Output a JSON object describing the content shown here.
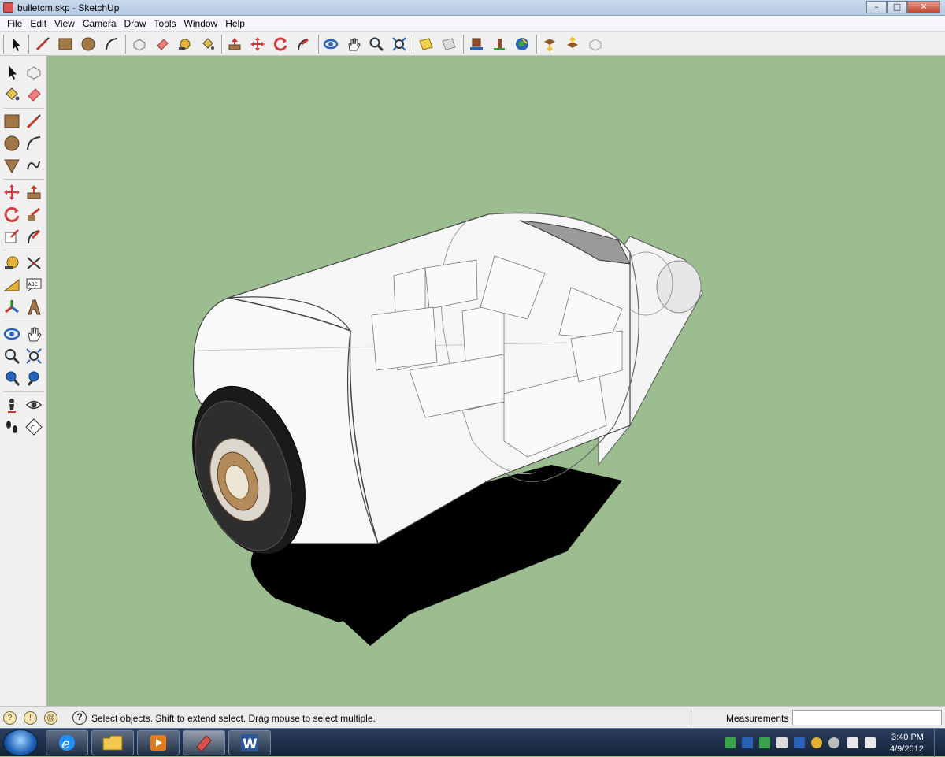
{
  "window": {
    "title": "bulletcm.skp - SketchUp",
    "buttons": {
      "minimize": "–",
      "maximize": "□",
      "close": "✕"
    }
  },
  "menu": [
    "File",
    "Edit",
    "View",
    "Camera",
    "Draw",
    "Tools",
    "Window",
    "Help"
  ],
  "toolbar": {
    "tools": [
      "select-icon",
      "line-icon",
      "rectangle-icon",
      "circle-icon",
      "arc-icon",
      "make-component-icon",
      "eraser-icon",
      "tape-measure-icon",
      "paint-bucket-icon",
      "push-pull-icon",
      "move-icon",
      "rotate-icon",
      "follow-me-icon",
      "orbit-icon",
      "pan-icon",
      "zoom-icon",
      "zoom-extents-icon",
      "add-location-icon",
      "toggle-terrain-icon",
      "get-models-icon",
      "share-model-icon",
      "place-model-icon",
      "get-components-icon",
      "share-component-icon",
      "send-to-layout-icon"
    ]
  },
  "left_tools": [
    "select-icon",
    "make-component-icon",
    "paint-bucket-icon",
    "eraser-icon",
    "rectangle-icon",
    "line-icon",
    "circle-icon",
    "arc-icon",
    "polygon-icon",
    "freehand-icon",
    "move-icon",
    "push-pull-icon",
    "rotate-icon",
    "follow-me-icon",
    "scale-icon",
    "offset-icon",
    "tape-measure-icon",
    "dimension-icon",
    "protractor-icon",
    "text-icon",
    "axes-icon",
    "3d-text-icon",
    "orbit-icon",
    "pan-icon",
    "zoom-icon",
    "zoom-window-icon",
    "zoom-extents-icon",
    "previous-view-icon",
    "position-camera-icon",
    "look-around-icon",
    "walk-icon",
    "section-plane-icon"
  ],
  "viewport": {
    "background": "#9cbd8f"
  },
  "status": {
    "message": "Select objects. Shift to extend select. Drag mouse to select multiple.",
    "measurements_label": "Measurements",
    "measurements_value": ""
  },
  "taskbar": {
    "apps": [
      "internet-explorer-icon",
      "windows-explorer-icon",
      "media-player-icon",
      "sketchup-icon",
      "word-icon"
    ],
    "active_app": "sketchup-icon",
    "time": "3:40 PM",
    "date": "4/9/2012"
  },
  "colors": {
    "viewport_bg": "#9cbd8f",
    "shadow": "#000000",
    "taskbar": "#1c2c45"
  }
}
